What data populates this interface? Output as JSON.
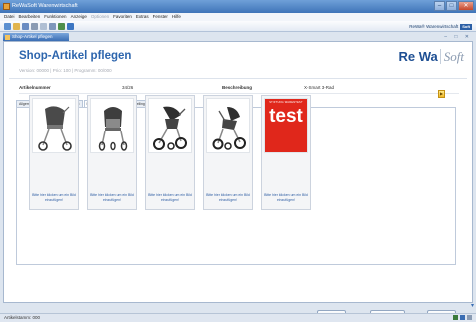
{
  "window": {
    "title": "ReWaSoft Warenwirtschaft"
  },
  "menu": [
    "Datei",
    "Bearbeiten",
    "Funktionen",
    "Anzeige",
    "Optionen",
    "Favoriten",
    "Extras",
    "Fenster",
    "Hilfe"
  ],
  "brand": {
    "name": "ReWa® Warenwirtschaft",
    "badge": "Soft"
  },
  "doc_tab": {
    "label": "Shop-Artikel pflegen"
  },
  "page": {
    "title": "Shop-Artikel pflegen",
    "subtitle": "Version: 00000 | Prio: 100 | Programm: 00/000"
  },
  "logo": {
    "rewa": "Re Wa",
    "soft": "Soft"
  },
  "article": {
    "number_label": "Artikelnummer",
    "number_value": "34/26",
    "description_label": "Beschreibung",
    "description_value": "X-Smart 3-Rad"
  },
  "tabs": [
    "Allgemeine Shopangaben",
    "Langtext",
    "Bilder",
    "Varianten",
    "Cross Selling",
    "Zubehör"
  ],
  "active_tab": "Bilder",
  "images": [
    {
      "caption": "Bitte hier klicken um ein Bild einzufügen!",
      "kind": "stroller-side"
    },
    {
      "caption": "Bitte hier klicken um ein Bild einzufügen!",
      "kind": "stroller-front"
    },
    {
      "caption": "Bitte hier klicken um ein Bild einzufügen!",
      "kind": "stroller-rear"
    },
    {
      "caption": "Bitte hier klicken um ein Bild einzufügen!",
      "kind": "stroller-angle"
    },
    {
      "caption": "Bitte hier klicken um ein Bild einzufügen!",
      "kind": "test-badge",
      "badge_top": "STIFTUNG WARENTEST",
      "badge_text": "test"
    }
  ],
  "buttons": {
    "back": "Zurück",
    "cancel": "Verlassen",
    "next": "Weiter"
  },
  "status": {
    "text": "Artikelstamm: 000"
  },
  "colors": {
    "accent": "#2d65ad",
    "badge_red": "#e0271b"
  }
}
